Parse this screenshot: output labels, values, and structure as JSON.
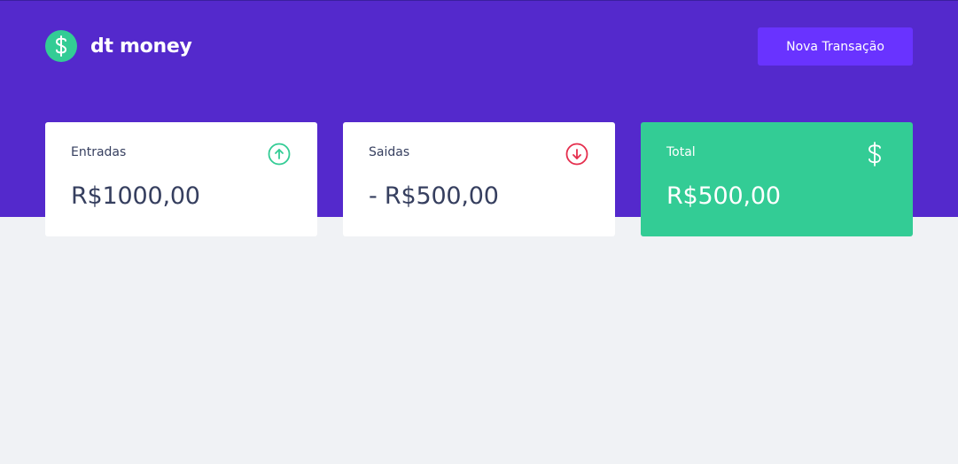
{
  "header": {
    "app_name": "dt money",
    "logo_icon": "dollar-icon",
    "new_transaction_label": "Nova Transação"
  },
  "summary": {
    "income": {
      "label": "Entradas",
      "value": "R$1000,00",
      "icon": "arrow-up-circle-icon"
    },
    "outcome": {
      "label": "Saidas",
      "value": "- R$500,00",
      "icon": "arrow-down-circle-icon"
    },
    "total": {
      "label": "Total",
      "value": "R$500,00",
      "icon": "dollar-icon"
    }
  },
  "colors": {
    "header_bg": "#5429cc",
    "button_bg": "#6933ff",
    "green": "#33cc95",
    "red": "#e52e4d",
    "text": "#363f5f",
    "page_bg": "#f0f2f5"
  }
}
